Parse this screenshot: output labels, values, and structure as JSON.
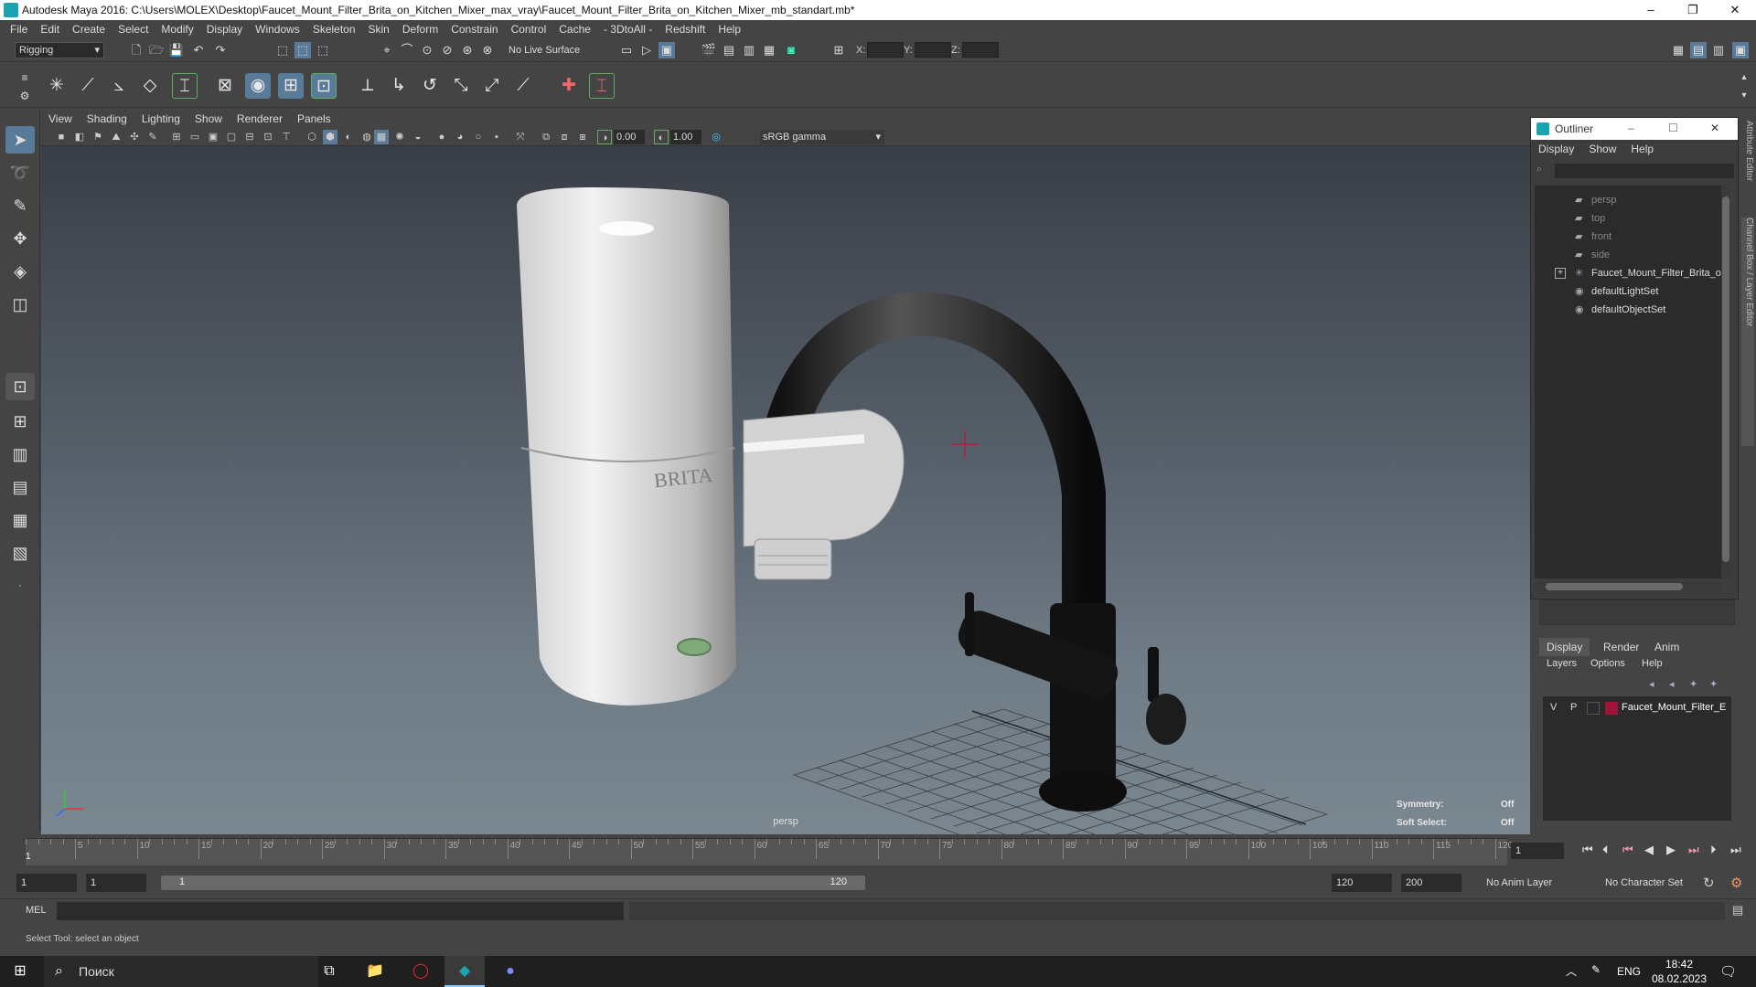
{
  "window": {
    "title": "Autodesk Maya 2016: C:\\Users\\MOLEX\\Desktop\\Faucet_Mount_Filter_Brita_on_Kitchen_Mixer_max_vray\\Faucet_Mount_Filter_Brita_on_Kitchen_Mixer_mb_standart.mb*",
    "min": "–",
    "max": "❐",
    "close": "✕"
  },
  "menubar": [
    "File",
    "Edit",
    "Create",
    "Select",
    "Modify",
    "Display",
    "Windows",
    "Skeleton",
    "Skin",
    "Deform",
    "Constrain",
    "Control",
    "Cache",
    "- 3DtoAll -",
    "Redshift",
    "Help"
  ],
  "statusline": {
    "menuset": "Rigging",
    "live_surface": "No Live Surface",
    "x_label": "X:",
    "y_label": "Y:",
    "z_label": "Z:"
  },
  "viewport": {
    "menus": [
      "View",
      "Shading",
      "Lighting",
      "Show",
      "Renderer",
      "Panels"
    ],
    "near_value": "0.00",
    "far_value": "1.00",
    "color_space": "sRGB gamma",
    "camera_label": "persp",
    "hud": {
      "symmetry_label": "Symmetry:",
      "symmetry_value": "Off",
      "soft_select_label": "Soft Select:",
      "soft_select_value": "Off"
    },
    "brand_text": "BRITA"
  },
  "outliner": {
    "title": "Outliner",
    "menus": [
      "Display",
      "Show",
      "Help"
    ],
    "items": [
      {
        "label": "persp",
        "icon": "camera-icon"
      },
      {
        "label": "top",
        "icon": "camera-icon"
      },
      {
        "label": "front",
        "icon": "camera-icon"
      },
      {
        "label": "side",
        "icon": "camera-icon"
      },
      {
        "label": "Faucet_Mount_Filter_Brita_on",
        "icon": "group-icon"
      },
      {
        "label": "defaultLightSet",
        "icon": "set-icon"
      },
      {
        "label": "defaultObjectSet",
        "icon": "set-icon"
      }
    ]
  },
  "sidetabs": [
    "Attribute Editor",
    "Channel Box / Layer Editor"
  ],
  "layer_editor": {
    "tabs": [
      "Display",
      "Render",
      "Anim"
    ],
    "menus": [
      "Layers",
      "Options",
      "Help"
    ],
    "layer": {
      "v": "V",
      "p": "P",
      "name": "Faucet_Mount_Filter_E",
      "color": "#a0143a"
    }
  },
  "timeline": {
    "ticks": [
      "5",
      "10",
      "15",
      "20",
      "25",
      "30",
      "35",
      "40",
      "45",
      "50",
      "55",
      "60",
      "65",
      "70",
      "75",
      "80",
      "85",
      "90",
      "95",
      "100",
      "105",
      "110",
      "115",
      "120"
    ],
    "start_marker": "1",
    "current_frame": "1"
  },
  "range": {
    "start": "1",
    "start2": "1",
    "range_start": "1",
    "range_end": "120",
    "end": "120",
    "end2": "200",
    "anim_layer": "No Anim Layer",
    "char_set": "No Character Set"
  },
  "cmdline": {
    "label": "MEL"
  },
  "helpline": {
    "text": "Select Tool: select an object"
  },
  "taskbar": {
    "search": "Поиск",
    "lang": "ENG",
    "time": "18:42",
    "date": "08.02.2023"
  }
}
